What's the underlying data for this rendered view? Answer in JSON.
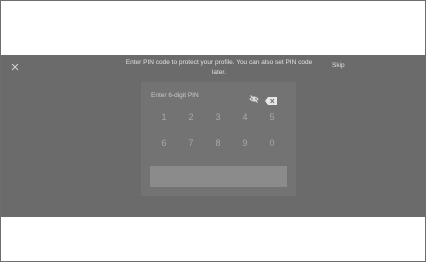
{
  "dialog": {
    "message": "Enter PIN code to protect your profile. You can also set PIN code later.",
    "skip_label": "Skip",
    "close_icon": "close-icon"
  },
  "pin_panel": {
    "prompt": "Enter 6-digit PIN",
    "visibility_icon": "eye-off-icon",
    "backspace_icon": "backspace-icon",
    "keys_row1": [
      "1",
      "2",
      "3",
      "4",
      "5"
    ],
    "keys_row2": [
      "6",
      "7",
      "8",
      "9",
      "0"
    ],
    "confirm_label": ""
  }
}
